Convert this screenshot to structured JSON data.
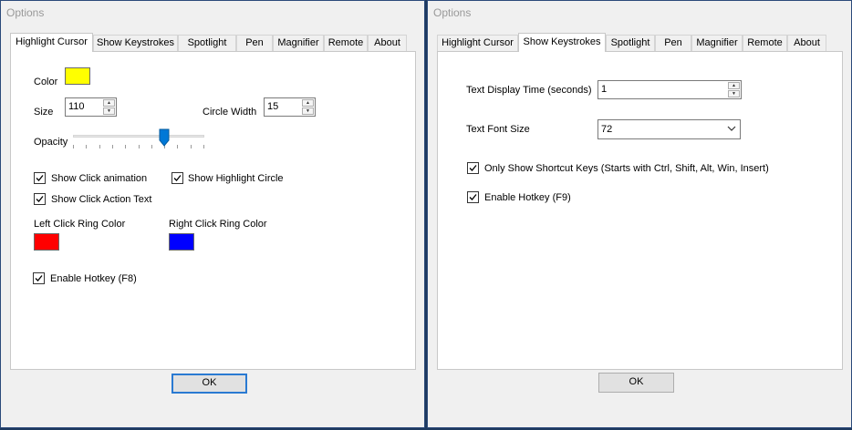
{
  "left": {
    "title": "Options",
    "tabs": [
      "Highlight Cursor",
      "Show Keystrokes",
      "Spotlight",
      "Pen",
      "Magnifier",
      "Remote",
      "About"
    ],
    "active_tab": "Highlight Cursor",
    "color_label": "Color",
    "color_value": "#ffff00",
    "size_label": "Size",
    "size_value": "110",
    "circle_width_label": "Circle Width",
    "circle_width_value": "15",
    "opacity_label": "Opacity",
    "opacity_level_fraction": 0.7,
    "show_click_animation": "Show Click animation",
    "show_highlight_circle": "Show Highlight Circle",
    "show_click_action_text": "Show Click Action Text",
    "left_ring_label": "Left Click Ring Color",
    "left_ring_color": "#ff0000",
    "right_ring_label": "Right Click Ring Color",
    "right_ring_color": "#0000ff",
    "enable_hotkey": "Enable Hotkey (F8)",
    "ok_label": "OK"
  },
  "right": {
    "title": "Options",
    "tabs": [
      "Highlight Cursor",
      "Show Keystrokes",
      "Spotlight",
      "Pen",
      "Magnifier",
      "Remote",
      "About"
    ],
    "active_tab": "Show Keystrokes",
    "text_display_time_label": "Text Display Time (seconds)",
    "text_display_time_value": "1",
    "text_font_size_label": "Text Font Size",
    "text_font_size_value": "72",
    "only_shortcut_keys": "Only Show Shortcut Keys (Starts with Ctrl, Shift, Alt, Win, Insert)",
    "enable_hotkey": "Enable Hotkey (F9)",
    "ok_label": "OK"
  },
  "icons": {
    "checkbox": "checkmark-icon",
    "spinner": "spin-arrow-icon",
    "dropdown": "chevron-down-icon",
    "slider": "slider-thumb-icon"
  }
}
